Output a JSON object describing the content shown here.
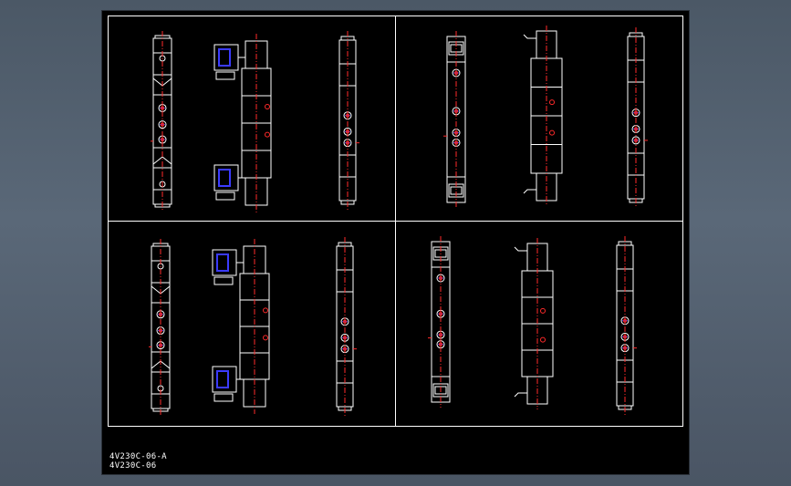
{
  "drawing": {
    "labels": [
      "4V230C-06-A",
      "4V230C-06"
    ],
    "colors": {
      "background": "#000000",
      "outline": "#ffffff",
      "centerline": "#ff2a2a",
      "port": "#3b3bff"
    },
    "quadrants": [
      "top-left",
      "top-right",
      "bottom-left",
      "bottom-right"
    ]
  }
}
